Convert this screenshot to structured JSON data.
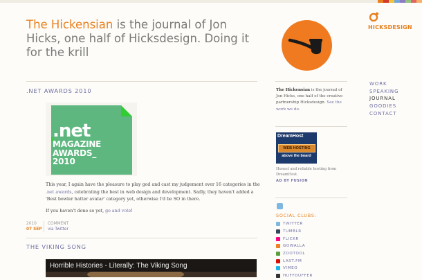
{
  "masthead": {
    "site_name": "The Hickensian",
    "tagline": " is the journal of Jon Hicks, one half of Hicksdesign. Doing it for the krill"
  },
  "brand": {
    "name": "HICKSDESIGN"
  },
  "colors": {
    "accent": "#e8801e",
    "link": "#6f6fa3",
    "net_badge": "#5eb77f",
    "strip": [
      "#e8801e",
      "#d33a2c",
      "#f2c23a",
      "#6fa8dc",
      "#8e7cc3",
      "#93c47d",
      "#e06666",
      "#f6b26b"
    ]
  },
  "nav": {
    "items": [
      {
        "label": "WORK",
        "active": false
      },
      {
        "label": "SPEAKING",
        "active": false
      },
      {
        "label": "JOURNAL",
        "active": true
      },
      {
        "label": "GOODIES",
        "active": false
      },
      {
        "label": "CONTACT",
        "active": false
      }
    ]
  },
  "post": {
    "title": ".NET AWARDS 2010",
    "badge": {
      "net": ".net",
      "line1": "MAGAZINE",
      "line2": "AWARDS_",
      "line3": "2010"
    },
    "para1_a": "This year, I again have the pleasure to play god and cast my judgement over 16 categories in the ",
    "para1_link": ".net awards",
    "para1_b": ", celebrating the best in web design and development. Sadly, they haven't added a 'Best bowler hatter avatar' category yet, otherwise I'd be SO in there.",
    "para2_a": "If you haven't done so yet, ",
    "para2_link": "go and vote",
    "para2_b": "!",
    "meta": {
      "year": "2010",
      "day": "07 SEP",
      "comment_label": "COMMENT",
      "comment_link": "via Twitter"
    }
  },
  "post2": {
    "title": "THE VIKING SONG",
    "video_title": "Horrible Histories - Literally: The Viking Song"
  },
  "sidebar": {
    "about_name": "The Hickensian",
    "about_text": " is the journal of Jon Hicks, one half of the creative partnership Hicksdesign. ",
    "about_link": "See the work we do.",
    "ad": {
      "logo": "DreamHost",
      "badge": "WEB HOSTING",
      "tag": "above the board",
      "caption": "Honest and reliable hosting from DreamHost.",
      "credit": "AD BY FUSION"
    },
    "social_heading": "SOCIAL CLUBS:",
    "social": [
      {
        "label": "TWITTER",
        "icon": "twitter-icon",
        "color": "#7fb7e0"
      },
      {
        "label": "TUMBLR",
        "icon": "tumblr-icon",
        "color": "#35465c"
      },
      {
        "label": "FLICKR",
        "icon": "flickr-icon",
        "color": "#ff0084"
      },
      {
        "label": "GOWALLA",
        "icon": "gowalla-icon",
        "color": "#f07f1f"
      },
      {
        "label": "ZOOTOOL",
        "icon": "zootool-icon",
        "color": "#5aa03c"
      },
      {
        "label": "LAST.FM",
        "icon": "lastfm-icon",
        "color": "#d51007"
      },
      {
        "label": "VIMEO",
        "icon": "vimeo-icon",
        "color": "#1ab7ea"
      },
      {
        "label": "HUFFDUFFER",
        "icon": "huffduffer-icon",
        "color": "#333333"
      }
    ]
  }
}
